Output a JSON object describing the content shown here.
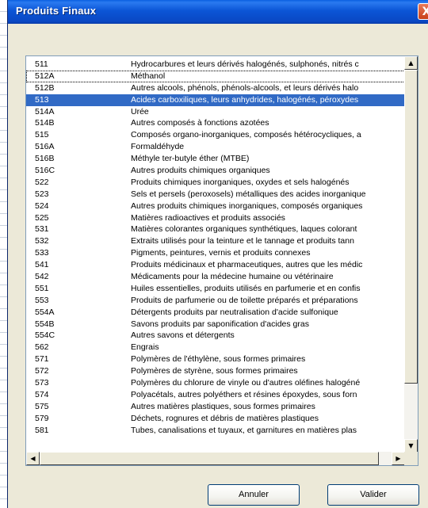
{
  "dialog": {
    "title": "Produits Finaux",
    "close_glyph": "X"
  },
  "list": {
    "rows": [
      {
        "code": "511",
        "desc": "Hydrocarbures et leurs dérivés halogénés, sulphonés, nitrés c"
      },
      {
        "code": "512A",
        "desc": "Méthanol"
      },
      {
        "code": "512B",
        "desc": "Autres alcools, phénols, phénols-alcools, et leurs dérivés halo"
      },
      {
        "code": "513",
        "desc": "Acides carboxiliques, leurs anhydrides, halogénés, péroxydes"
      },
      {
        "code": "514A",
        "desc": "Urée"
      },
      {
        "code": "514B",
        "desc": "Autres composés à fonctions azotées"
      },
      {
        "code": "515",
        "desc": "Composés organo-inorganiques, composés hétérocycliques, a"
      },
      {
        "code": "516A",
        "desc": "Formaldéhyde"
      },
      {
        "code": "516B",
        "desc": "Méthyle ter-butyle éther (MTBE)"
      },
      {
        "code": "516C",
        "desc": "Autres produits chimiques organiques"
      },
      {
        "code": "522",
        "desc": "Produits chimiques inorganiques, oxydes et sels halogénés"
      },
      {
        "code": "523",
        "desc": "Sels et persels (peroxosels) métalliques des acides inorganique"
      },
      {
        "code": "524",
        "desc": "Autres produits chimiques inorganiques, composés organiques"
      },
      {
        "code": "525",
        "desc": "Matières radioactives et produits associés"
      },
      {
        "code": "531",
        "desc": "Matières colorantes organiques synthétiques, laques colorant"
      },
      {
        "code": "532",
        "desc": "Extraits utilisés pour la teinture et le tannage et produits tann"
      },
      {
        "code": "533",
        "desc": "Pigments, peintures, vernis et produits connexes"
      },
      {
        "code": "541",
        "desc": "Produits médicinaux et pharmaceutiques, autres que les médic"
      },
      {
        "code": "542",
        "desc": "Médicaments pour la médecine humaine ou vétérinaire"
      },
      {
        "code": "551",
        "desc": "Huiles essentielles, produits utilisés en parfumerie et en confis"
      },
      {
        "code": "553",
        "desc": "Produits de parfumerie ou de toilette préparés et préparations"
      },
      {
        "code": "554A",
        "desc": "Détergents produits par neutralisation d'acide sulfonique"
      },
      {
        "code": "554B",
        "desc": "Savons produits par saponification d'acides gras"
      },
      {
        "code": "554C",
        "desc": "Autres savons et détergents"
      },
      {
        "code": "562",
        "desc": "Engrais"
      },
      {
        "code": "571",
        "desc": "Polymères de l'éthylène, sous formes primaires"
      },
      {
        "code": "572",
        "desc": "Polymères de styrène, sous formes primaires"
      },
      {
        "code": "573",
        "desc": "Polymères du chlorure de vinyle ou d'autres oléfines halogéné"
      },
      {
        "code": "574",
        "desc": "Polyacétals, autres polyéthers et résines époxydes, sous forn"
      },
      {
        "code": "575",
        "desc": "Autres matières plastiques, sous formes primaires"
      },
      {
        "code": "579",
        "desc": "Déchets, rognures et débris de matières plastiques"
      },
      {
        "code": "581",
        "desc": "Tubes, canalisations et tuyaux, et garnitures en matières plas"
      }
    ],
    "selected_code": "513",
    "focused_code": "512A"
  },
  "buttons": {
    "cancel_label": "Annuler",
    "ok_label": "Valider"
  },
  "colors": {
    "selection": "#316ac5",
    "titlebar": "#0a55d6"
  }
}
